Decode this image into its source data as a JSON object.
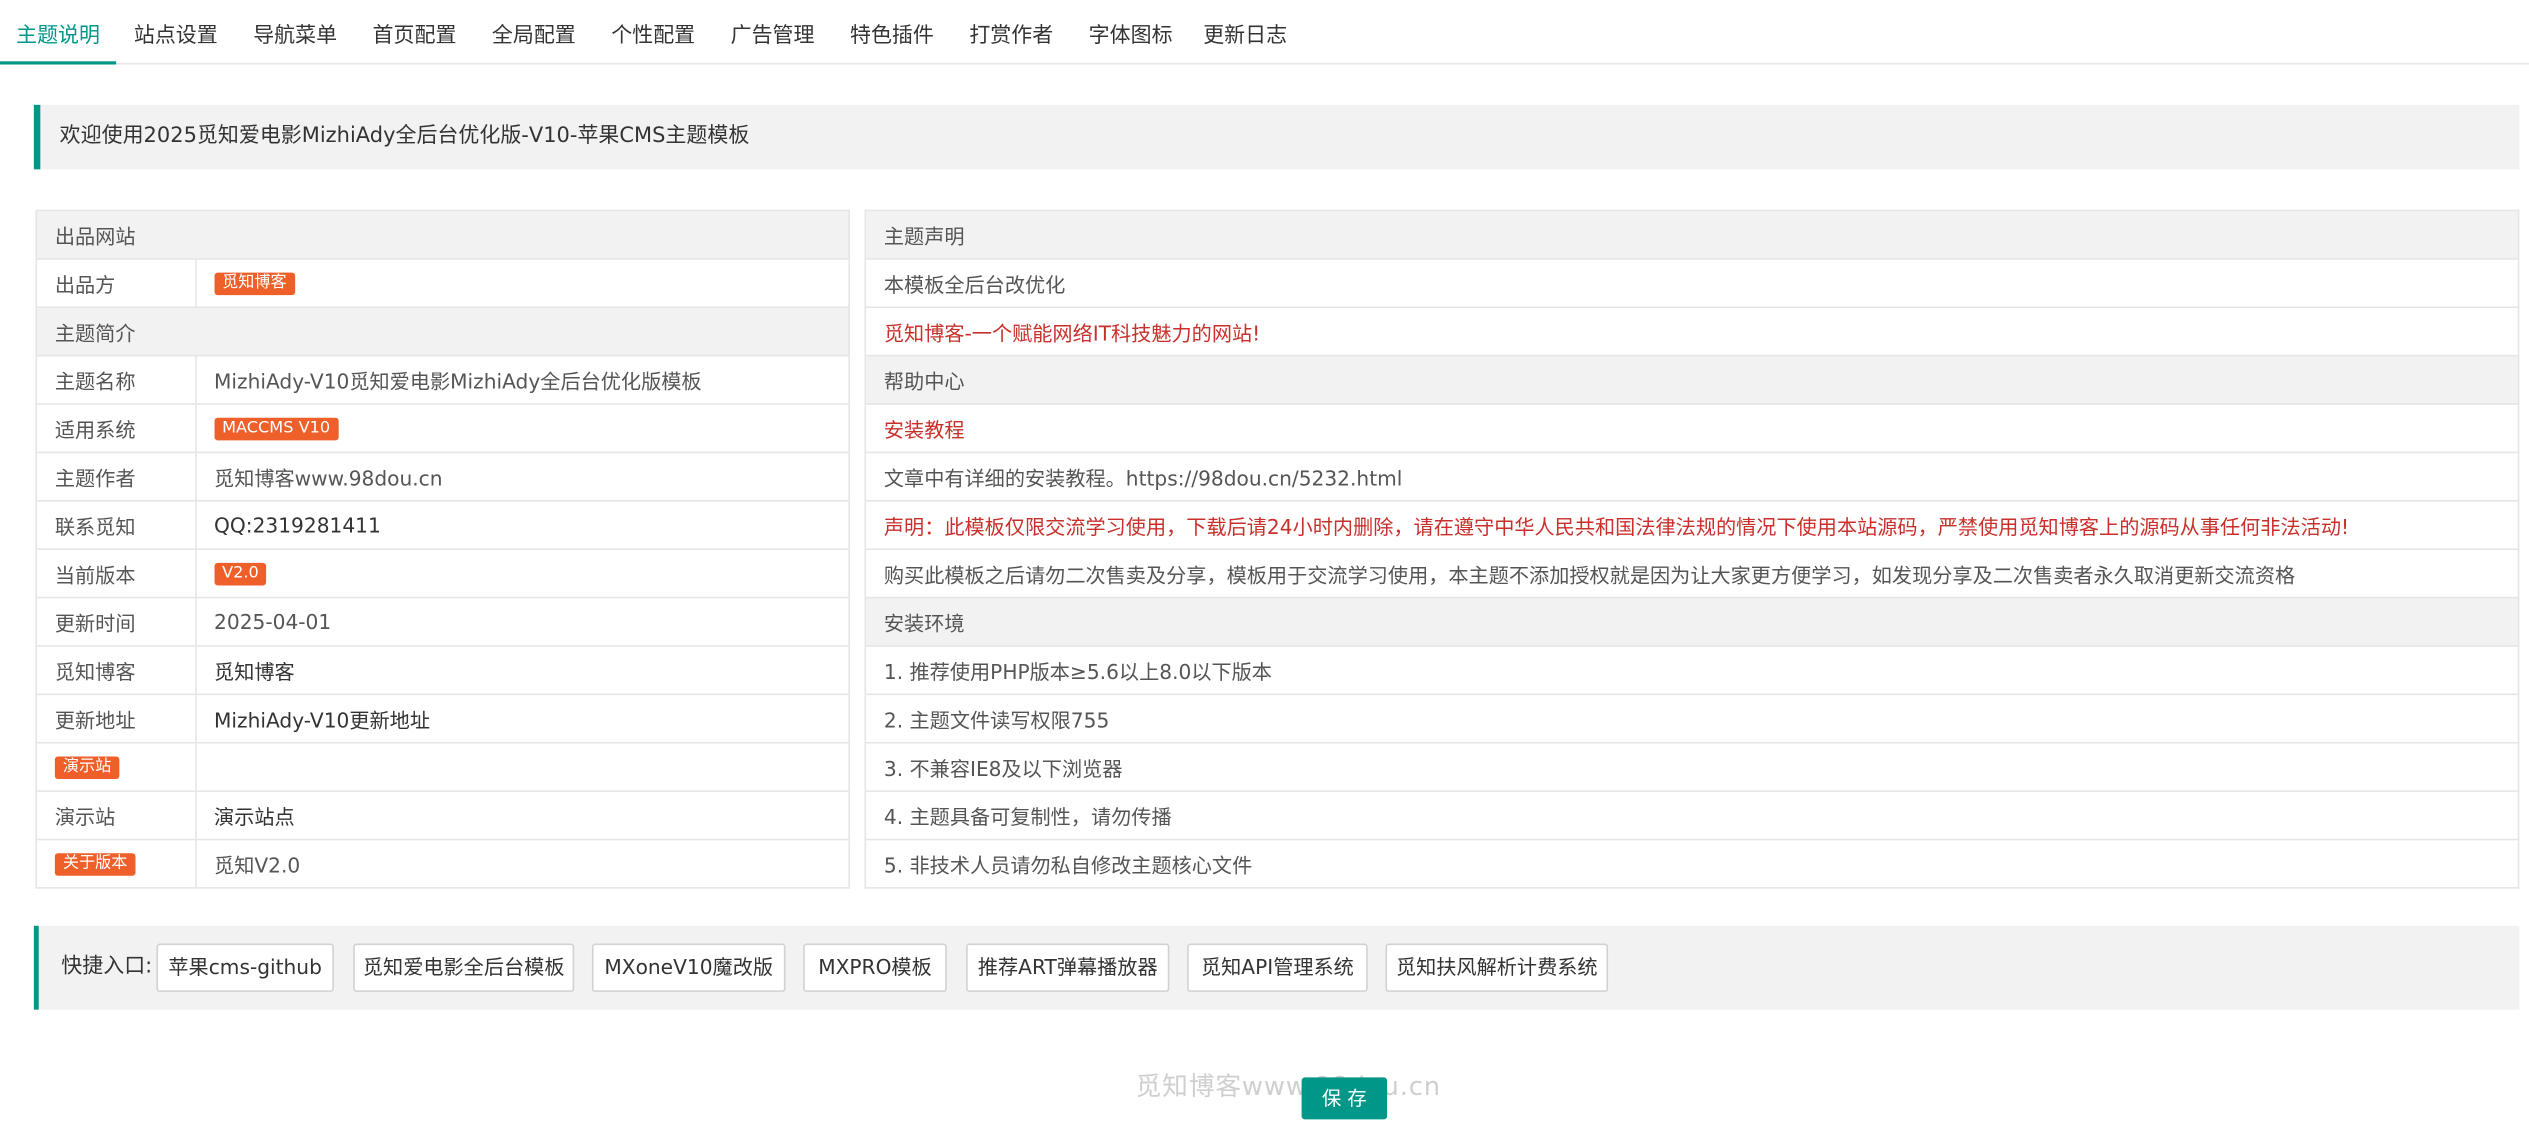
{
  "tabs": [
    "主题说明",
    "站点设置",
    "导航菜单",
    "首页配置",
    "全局配置",
    "个性配置",
    "广告管理",
    "特色插件",
    "打赏作者",
    "字体图标",
    "更新日志"
  ],
  "welcome": "欢迎使用2025觅知爱电影MizhiAdy全后台优化版-V10-苹果CMS主题模板",
  "left": {
    "h1": "出品网站",
    "r1": {
      "k": "出品方",
      "badge": "觅知博客"
    },
    "h2": "主题简介",
    "r2": {
      "k": "主题名称",
      "v": "MizhiAdy-V10觅知爱电影MizhiAdy全后台优化版模板"
    },
    "r3": {
      "k": "适用系统",
      "badge": "MACCMS V10"
    },
    "r4": {
      "k": "主题作者",
      "v": "觅知博客www.98dou.cn"
    },
    "r5": {
      "k": "联系觅知",
      "v": "QQ:2319281411"
    },
    "r6": {
      "k": "当前版本",
      "badge": "V2.0"
    },
    "r7": {
      "k": "更新时间",
      "v": "2025-04-01"
    },
    "r8": {
      "k": "觅知博客",
      "v": "觅知博客"
    },
    "r9": {
      "k": "更新地址",
      "v": "MizhiAdy-V10更新地址"
    },
    "r10": {
      "badge": "演示站"
    },
    "r11": {
      "k": "演示站",
      "v": "演示站点"
    },
    "r12": {
      "badge": "关于版本",
      "v": "觅知V2.0"
    }
  },
  "right": {
    "h1": "主题声明",
    "r1": "本模板全后台改优化",
    "r2": "觅知博客-一个赋能网络IT科技魅力的网站!",
    "h2": "帮助中心",
    "r3": "安装教程",
    "r4": "文章中有详细的安装教程。https://98dou.cn/5232.html",
    "r5": "声明：此模板仅限交流学习使用，下载后请24小时内删除，请在遵守中华人民共和国法律法规的情况下使用本站源码，严禁使用觅知博客上的源码从事任何非法活动!",
    "r6": "购买此模板之后请勿二次售卖及分享，模板用于交流学习使用，本主题不添加授权就是因为让大家更方便学习，如发现分享及二次售卖者永久取消更新交流资格",
    "h3": "安装环境",
    "r7": "1. 推荐使用PHP版本≥5.6以上8.0以下版本",
    "r8": "2. 主题文件读写权限755",
    "r9": "3. 不兼容IE8及以下浏览器",
    "r10": "4. 主题具备可复制性，请勿传播",
    "r11": "5. 非技术人员请勿私自修改主题核心文件"
  },
  "shortcut": {
    "label": "快捷入口:",
    "buttons": [
      "苹果cms-github",
      "觅知爱电影全后台模板",
      "MXoneV10魔改版",
      "MXPRO模板",
      "推荐ART弹幕播放器",
      "觅知API管理系统",
      "觅知扶风解析计费系统"
    ]
  },
  "watermark": "觅知博客www.98dou.cn",
  "save_label": "保 存",
  "colors": {
    "accent": "#009688",
    "badge": "#ee5f2a",
    "warn_text": "#c9302c"
  }
}
